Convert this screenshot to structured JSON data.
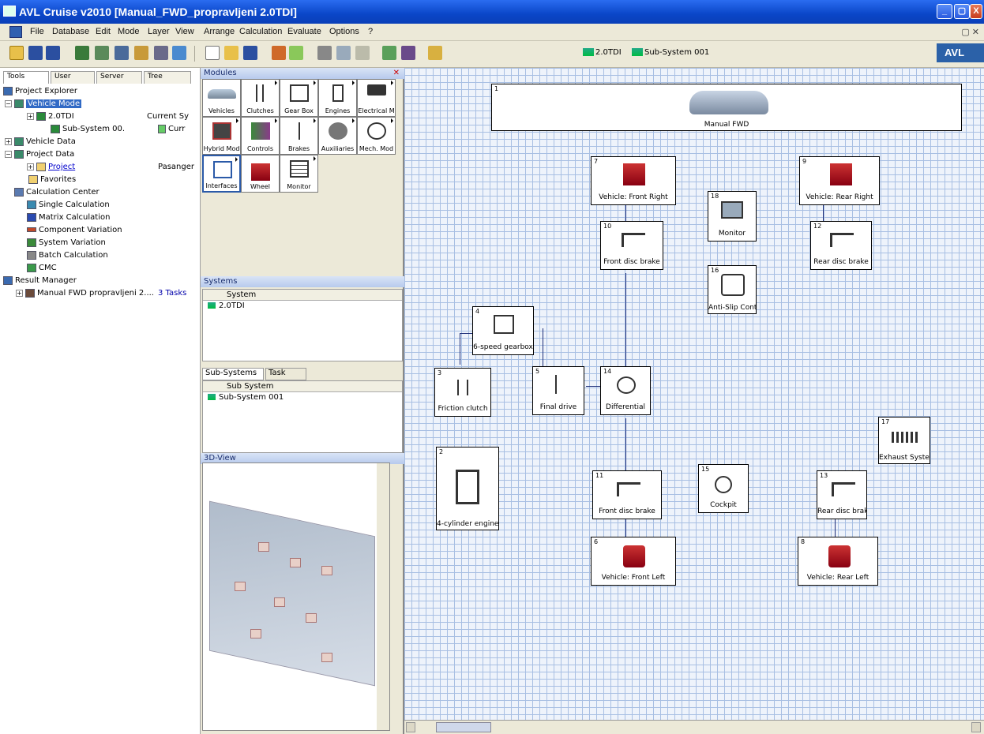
{
  "window": {
    "title": "AVL Cruise v2010 [Manual_FWD_propravljeni 2.0TDI]",
    "min_btn": "_",
    "max_btn": "▢",
    "close_btn": "X"
  },
  "menu": {
    "items": [
      "File",
      "Database",
      "Edit",
      "Mode",
      "Layer",
      "View",
      "Arrange",
      "Calculation",
      "Evaluate",
      "Options",
      "?"
    ],
    "right_controls": "▢ ✕"
  },
  "toolbar": {
    "breadcrumb_model": "2.0TDI",
    "breadcrumb_subsystem": "Sub-System 001",
    "brand": "AVL"
  },
  "left": {
    "tabs": [
      "Tools",
      "User",
      "Server",
      "Tree"
    ],
    "tree": {
      "project_explorer": "Project Explorer",
      "vehicle_model": "Vehicle Mode",
      "model_20tdi": "2.0TDI",
      "current_system": "Current Sy",
      "subsystem": "Sub-System 00.",
      "subsystem_status": "Curr",
      "vehicle_data": "Vehicle Data",
      "project_data": "Project Data",
      "project": "Project",
      "project_value": "Pasanger",
      "favorites": "Favorites",
      "calc_center": "Calculation Center",
      "single_calc": "Single Calculation",
      "matrix_calc": "Matrix Calculation",
      "component_variation": "Component Variation",
      "system_variation": "System Variation",
      "batch_calc": "Batch Calculation",
      "cmc": "CMC",
      "result_manager": "Result Manager",
      "result_item": "Manual FWD propravljeni 2....",
      "result_tasks": "3 Tasks"
    }
  },
  "middle": {
    "modules_title": "Modules",
    "modules": [
      "Vehicles",
      "Clutches",
      "Gear Box",
      "Engines",
      "Electrical M",
      "Hybrid Mod",
      "Controls",
      "Brakes",
      "Auxiliaries",
      "Mech. Mod",
      "Interfaces",
      "Wheel",
      "Monitor"
    ],
    "systems_title": "Systems",
    "systems_col": "System",
    "systems_rows": [
      "2.0TDI"
    ],
    "subsys_tabs": [
      "Sub-Systems",
      "Task"
    ],
    "subsys_col": "Sub System",
    "subsys_rows": [
      "Sub-System 001"
    ],
    "view3d_title": "3D-View"
  },
  "canvas": {
    "components": {
      "vehicle": {
        "num": "1",
        "name": "Manual FWD"
      },
      "gearbox": {
        "num": "4",
        "name": "6-speed gearbox"
      },
      "clutch": {
        "num": "3",
        "name": "Friction clutch"
      },
      "final_drive": {
        "num": "5",
        "name": "Final drive"
      },
      "differential": {
        "num": "14",
        "name": "Differential"
      },
      "engine": {
        "num": "2",
        "name": "4-cylinder engine"
      },
      "veh_front_right": {
        "num": "7",
        "name": "Vehicle: Front Right"
      },
      "veh_rear_right": {
        "num": "9",
        "name": "Vehicle: Rear Right"
      },
      "front_disc_brake_top": {
        "num": "10",
        "name": "Front disc brake"
      },
      "rear_disc_brake_top": {
        "num": "12",
        "name": "Rear disc brake"
      },
      "monitor": {
        "num": "18",
        "name": "Monitor"
      },
      "asc": {
        "num": "16",
        "name": "Anti-Slip Control"
      },
      "front_disc_brake_bot": {
        "num": "11",
        "name": "Front disc brake"
      },
      "cockpit": {
        "num": "15",
        "name": "Cockpit"
      },
      "rear_disc_brake_bot": {
        "num": "13",
        "name": "Rear disc brake"
      },
      "exhaust": {
        "num": "17",
        "name": "Exhaust System"
      },
      "veh_front_left": {
        "num": "6",
        "name": "Vehicle: Front Left"
      },
      "veh_rear_left": {
        "num": "8",
        "name": "Vehicle: Rear Left"
      }
    }
  }
}
